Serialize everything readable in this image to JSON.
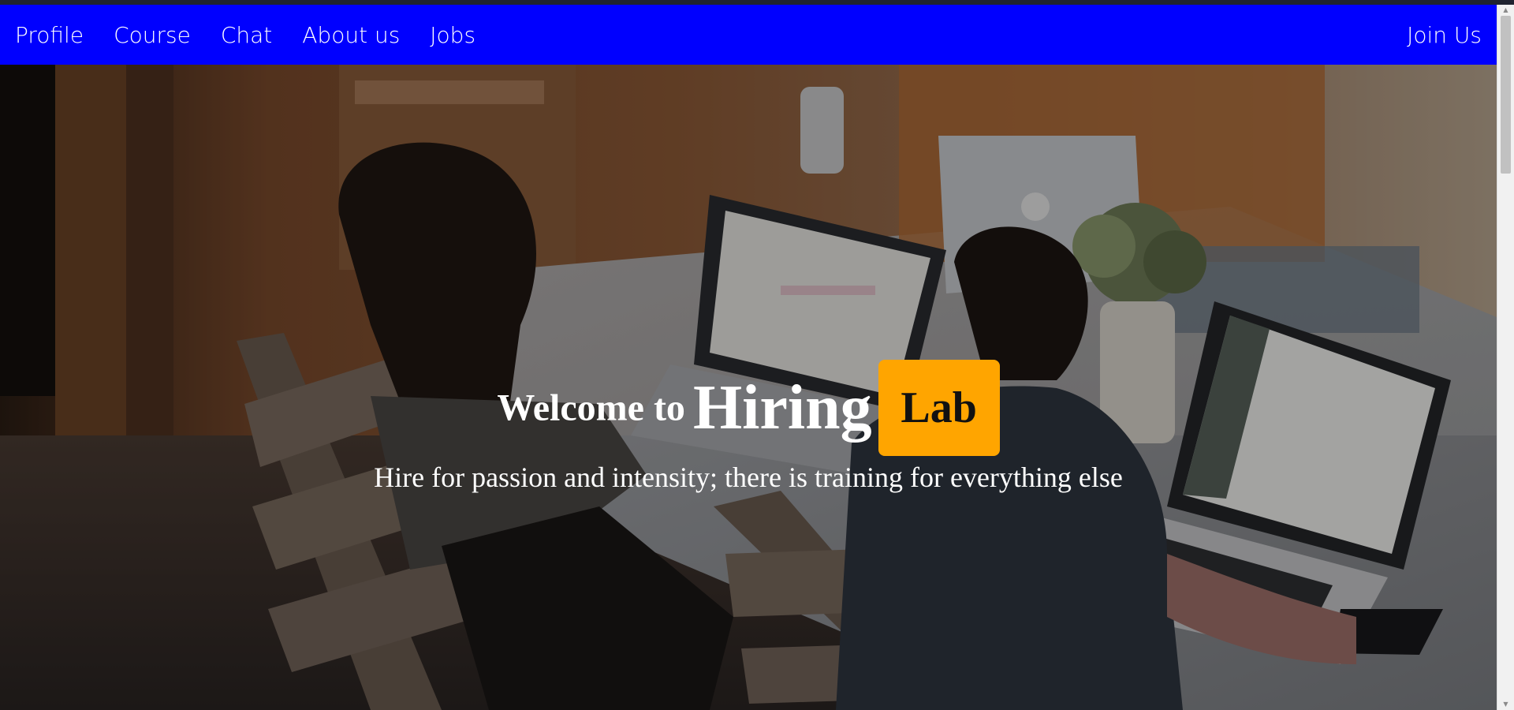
{
  "nav": {
    "links": [
      "Profile",
      "Course",
      "Chat",
      "About us",
      "Jobs"
    ],
    "join_label": "Join Us",
    "background_color": "#0000ff"
  },
  "hero": {
    "welcome": "Welcome to",
    "brand": "Hiring",
    "badge": "Lab",
    "badge_color": "#ffa500",
    "tagline": "Hire for passion and intensity; there is training for everything else"
  },
  "icons": {
    "scroll_up": "scroll-up-arrow-icon",
    "scroll_down": "scroll-down-arrow-icon"
  }
}
